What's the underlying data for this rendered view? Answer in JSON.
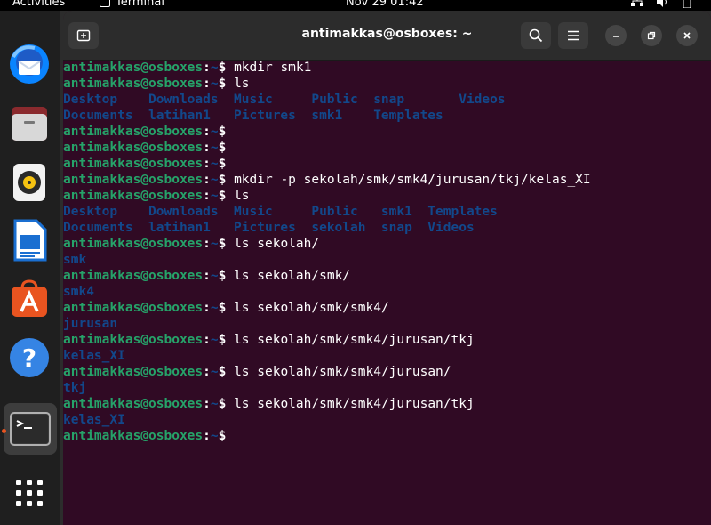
{
  "topbar": {
    "activities": "Activities",
    "app_name": "Terminal",
    "clock": "Nov 29  01:42"
  },
  "dock": {
    "items": [
      {
        "name": "thunderbird-icon"
      },
      {
        "name": "files-icon"
      },
      {
        "name": "rhythmbox-icon"
      },
      {
        "name": "libreoffice-writer-icon"
      },
      {
        "name": "ubuntu-software-icon"
      },
      {
        "name": "help-icon"
      },
      {
        "name": "terminal-icon"
      },
      {
        "name": "show-applications-icon"
      }
    ]
  },
  "window": {
    "title": "antimakkas@osboxes: ~"
  },
  "terminal": {
    "prompt_user": "antimakkas@osboxes",
    "prompt_colon": ":",
    "prompt_path": "~",
    "prompt_dollar": "$ ",
    "lines": [
      {
        "type": "prompt",
        "cmd": "mkdir smk1"
      },
      {
        "type": "prompt",
        "cmd": "ls"
      },
      {
        "type": "out",
        "text": "Desktop    Downloads  Music     Public  snap       Videos"
      },
      {
        "type": "out",
        "text": "Documents  latihan1   Pictures  smk1    Templates"
      },
      {
        "type": "prompt",
        "cmd": ""
      },
      {
        "type": "prompt",
        "cmd": ""
      },
      {
        "type": "prompt",
        "cmd": ""
      },
      {
        "type": "prompt",
        "cmd": "mkdir -p sekolah/smk/smk4/jurusan/tkj/kelas_XI"
      },
      {
        "type": "prompt",
        "cmd": "ls"
      },
      {
        "type": "out",
        "text": "Desktop    Downloads  Music     Public   smk1  Templates"
      },
      {
        "type": "out",
        "text": "Documents  latihan1   Pictures  sekolah  snap  Videos"
      },
      {
        "type": "prompt",
        "cmd": "ls sekolah/"
      },
      {
        "type": "out",
        "text": "smk"
      },
      {
        "type": "prompt",
        "cmd": "ls sekolah/smk/"
      },
      {
        "type": "out",
        "text": "smk4"
      },
      {
        "type": "prompt",
        "cmd": "ls sekolah/smk/smk4/"
      },
      {
        "type": "out",
        "text": "jurusan"
      },
      {
        "type": "prompt",
        "cmd": "ls sekolah/smk/smk4/jurusan/tkj"
      },
      {
        "type": "out",
        "text": "kelas_XI"
      },
      {
        "type": "prompt",
        "cmd": "ls sekolah/smk/smk4/jurusan/"
      },
      {
        "type": "out",
        "text": "tkj"
      },
      {
        "type": "prompt",
        "cmd": "ls sekolah/smk/smk4/jurusan/tkj"
      },
      {
        "type": "out",
        "text": "kelas_XI"
      },
      {
        "type": "prompt",
        "cmd": ""
      }
    ]
  }
}
